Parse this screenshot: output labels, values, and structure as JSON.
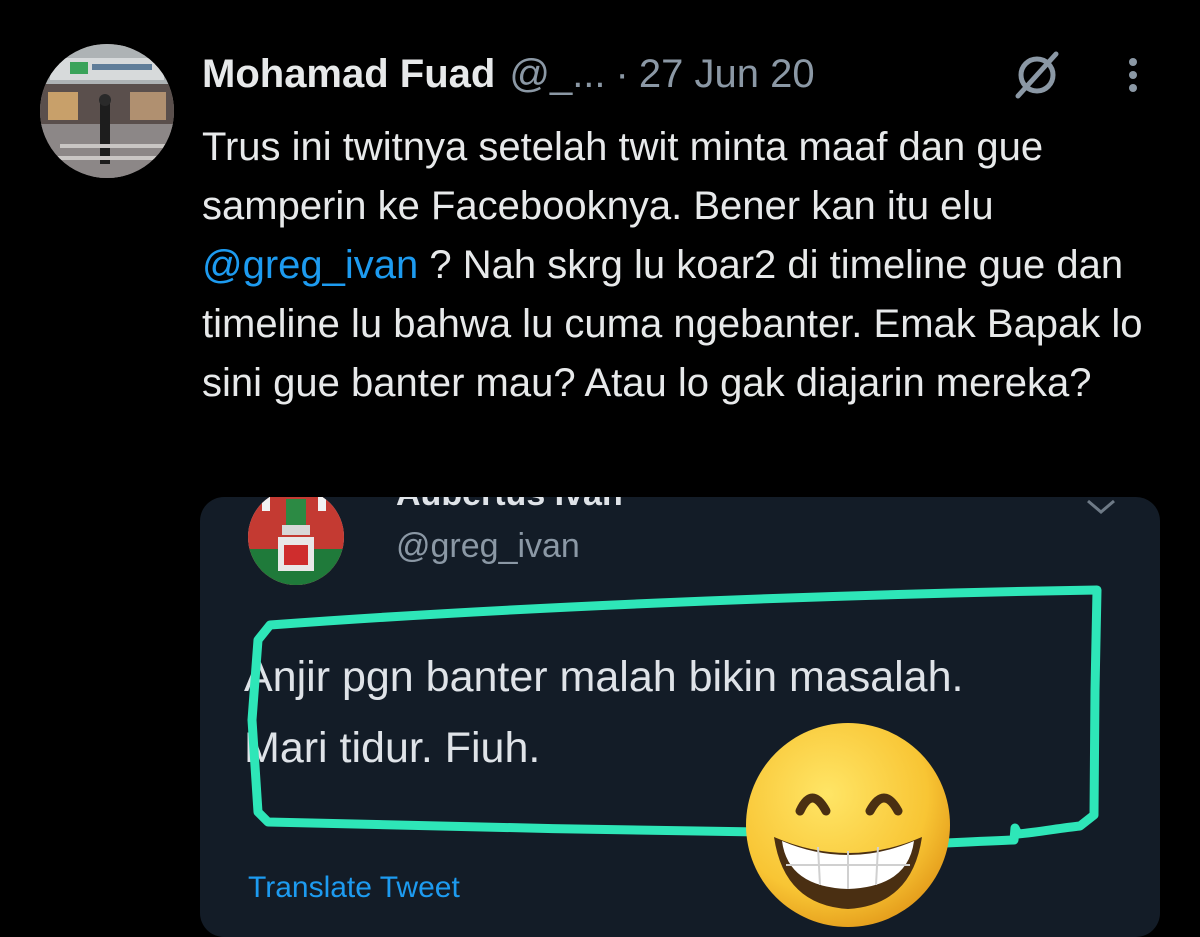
{
  "tweet": {
    "author_name": "Mohamad Fuad",
    "author_handle": "@_...",
    "separator": "·",
    "date": "27 Jun 20",
    "icons": [
      "grok-icon",
      "more-icon"
    ],
    "text_before": "Trus ini twitnya setelah twit minta maaf dan gue samperin ke Facebooknya. Bener kan itu elu",
    "mention": "@greg_ivan",
    "text_after": "? Nah skrg lu koar2 di timeline gue dan timeline lu bahwa lu cuma ngebanter. Emak Bapak lo sini gue banter mau? Atau lo gak diajarin mereka?"
  },
  "embedded": {
    "author_name": "Aubertus Ivan",
    "author_handle": "@greg_ivan",
    "text_line1": "Anjir pgn banter malah bikin masalah.",
    "text_line2": "Mari tidur. Fiuh.",
    "translate_label": "Translate Tweet"
  },
  "colors": {
    "background": "#000000",
    "text": "#e7e9ea",
    "secondary": "#8b98a5",
    "accent": "#1d9bf0",
    "embed_background": "#131c27",
    "highlight_stroke": "#2ee6b8"
  },
  "decorations": {
    "emoji": "grinning-face-emoji"
  }
}
